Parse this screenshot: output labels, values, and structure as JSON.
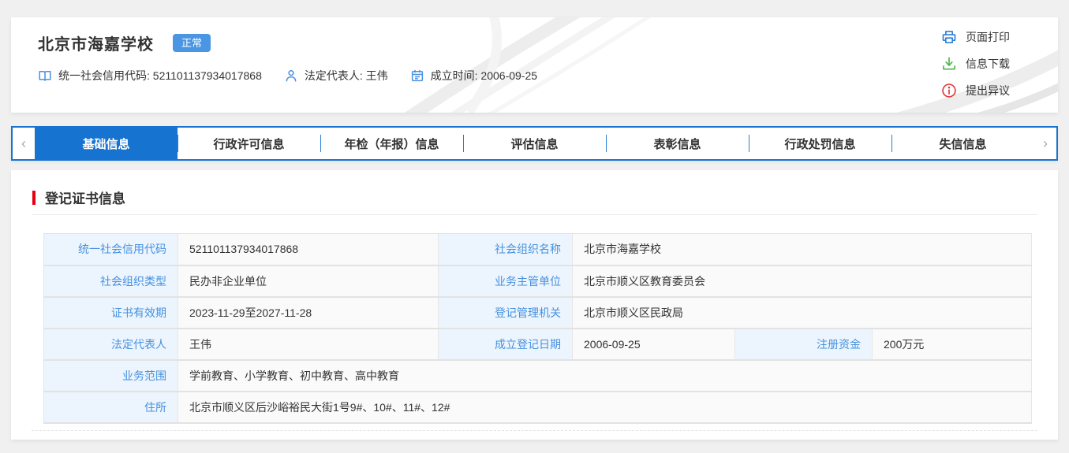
{
  "header": {
    "title": "北京市海嘉学校",
    "status_badge": "正常",
    "info_items": [
      {
        "icon": "book-icon",
        "text": "统一社会信用代码: 521101137934017868"
      },
      {
        "icon": "person-icon",
        "text": "法定代表人: 王伟"
      },
      {
        "icon": "calendar-icon",
        "text": "成立时间: 2006-09-25"
      }
    ],
    "actions": [
      {
        "icon": "printer-icon",
        "label": "页面打印"
      },
      {
        "icon": "download-icon",
        "label": "信息下载"
      },
      {
        "icon": "dispute-icon",
        "label": "提出异议"
      }
    ]
  },
  "tabs": {
    "prev_arrow": "‹",
    "next_arrow": "›",
    "items": [
      {
        "label": "基础信息",
        "active": true
      },
      {
        "label": "行政许可信息",
        "active": false
      },
      {
        "label": "年检（年报）信息",
        "active": false
      },
      {
        "label": "评估信息",
        "active": false
      },
      {
        "label": "表彰信息",
        "active": false
      },
      {
        "label": "行政处罚信息",
        "active": false
      },
      {
        "label": "失信信息",
        "active": false
      }
    ]
  },
  "section": {
    "title": "登记证书信息"
  },
  "registration_table": {
    "rows": [
      {
        "cells": [
          "统一社会信用代码",
          "521101137934017868",
          "社会组织名称",
          "北京市海嘉学校"
        ]
      },
      {
        "cells": [
          "社会组织类型",
          "民办非企业单位",
          "业务主管单位",
          "北京市顺义区教育委员会"
        ]
      },
      {
        "cells": [
          "证书有效期",
          "2023-11-29至2027-11-28",
          "登记管理机关",
          "北京市顺义区民政局"
        ]
      },
      {
        "cells": [
          "法定代表人",
          "王伟",
          "成立登记日期",
          "2006-09-25",
          "注册资金",
          "200万元"
        ]
      },
      {
        "cells": [
          "业务范围",
          "学前教育、小学教育、初中教育、高中教育"
        ]
      },
      {
        "cells": [
          "住所",
          "北京市顺义区后沙峪裕民大街1号9#、10#、11#、12#"
        ]
      }
    ]
  },
  "colors": {
    "accent_blue": "#1673d0",
    "badge_blue": "#4a96e2",
    "label_blue": "#4691e0",
    "download_green": "#52b54b",
    "dispute_red": "#e23b3b",
    "section_red": "#e60012"
  }
}
